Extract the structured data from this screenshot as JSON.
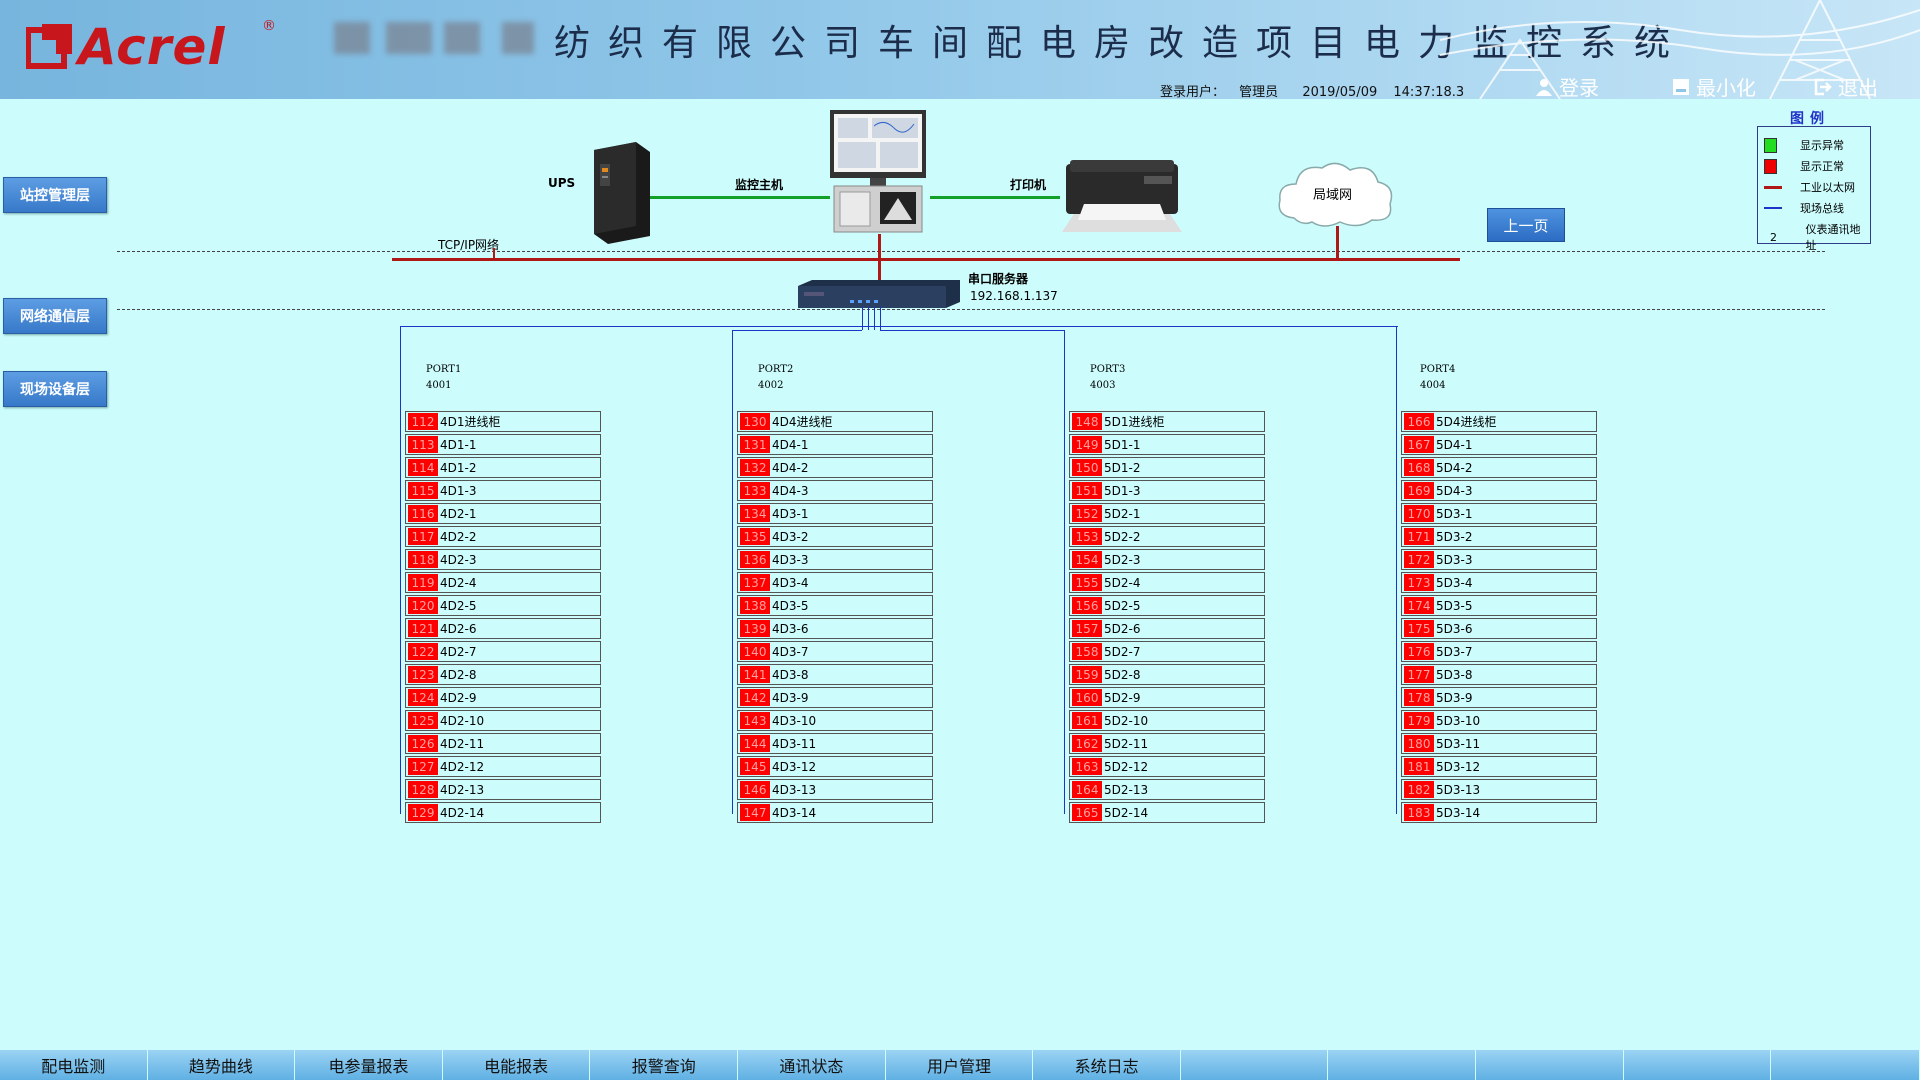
{
  "header": {
    "logo_text": "Acrel",
    "logo_reg": "®",
    "title": "纺织有限公司车间配电房改造项目电力监控系统",
    "login_label": "登录用户：",
    "user": "管理员",
    "date": "2019/05/09",
    "time": "14:37:18.3",
    "buttons": {
      "login": "登录",
      "minimize": "最小化",
      "exit": "退出"
    }
  },
  "layers": {
    "station": "站控管理层",
    "network": "网络通信层",
    "field": "现场设备层"
  },
  "network": {
    "tcp_label": "TCP/IP网络",
    "ups": "UPS",
    "host": "监控主机",
    "printer": "打印机",
    "lan": "局域网",
    "server_title": "串口服务器",
    "server_ip": "192.168.1.137",
    "prev_page": "上一页"
  },
  "legend": {
    "title": "图例",
    "items": [
      {
        "symbol": "green-square",
        "label": "显示异常",
        "color": "#22dd22"
      },
      {
        "symbol": "red-square",
        "label": "显示正常",
        "color": "#ee0000"
      },
      {
        "symbol": "red-line",
        "label": "工业以太网",
        "color": "#b01818"
      },
      {
        "symbol": "blue-line",
        "label": "现场总线",
        "color": "#1d35c7"
      },
      {
        "symbol": "number",
        "label": "仪表通讯地址",
        "text": "2"
      }
    ]
  },
  "ports": [
    {
      "name": "PORT1",
      "num": "4001",
      "devices": [
        {
          "addr": "112",
          "name": "4D1进线柜"
        },
        {
          "addr": "113",
          "name": "4D1-1"
        },
        {
          "addr": "114",
          "name": "4D1-2"
        },
        {
          "addr": "115",
          "name": "4D1-3"
        },
        {
          "addr": "116",
          "name": "4D2-1"
        },
        {
          "addr": "117",
          "name": "4D2-2"
        },
        {
          "addr": "118",
          "name": "4D2-3"
        },
        {
          "addr": "119",
          "name": "4D2-4"
        },
        {
          "addr": "120",
          "name": "4D2-5"
        },
        {
          "addr": "121",
          "name": "4D2-6"
        },
        {
          "addr": "122",
          "name": "4D2-7"
        },
        {
          "addr": "123",
          "name": "4D2-8"
        },
        {
          "addr": "124",
          "name": "4D2-9"
        },
        {
          "addr": "125",
          "name": "4D2-10"
        },
        {
          "addr": "126",
          "name": "4D2-11"
        },
        {
          "addr": "127",
          "name": "4D2-12"
        },
        {
          "addr": "128",
          "name": "4D2-13"
        },
        {
          "addr": "129",
          "name": "4D2-14"
        }
      ]
    },
    {
      "name": "PORT2",
      "num": "4002",
      "devices": [
        {
          "addr": "130",
          "name": "4D4进线柜"
        },
        {
          "addr": "131",
          "name": "4D4-1"
        },
        {
          "addr": "132",
          "name": "4D4-2"
        },
        {
          "addr": "133",
          "name": "4D4-3"
        },
        {
          "addr": "134",
          "name": "4D3-1"
        },
        {
          "addr": "135",
          "name": "4D3-2"
        },
        {
          "addr": "136",
          "name": "4D3-3"
        },
        {
          "addr": "137",
          "name": "4D3-4"
        },
        {
          "addr": "138",
          "name": "4D3-5"
        },
        {
          "addr": "139",
          "name": "4D3-6"
        },
        {
          "addr": "140",
          "name": "4D3-7"
        },
        {
          "addr": "141",
          "name": "4D3-8"
        },
        {
          "addr": "142",
          "name": "4D3-9"
        },
        {
          "addr": "143",
          "name": "4D3-10"
        },
        {
          "addr": "144",
          "name": "4D3-11"
        },
        {
          "addr": "145",
          "name": "4D3-12"
        },
        {
          "addr": "146",
          "name": "4D3-13"
        },
        {
          "addr": "147",
          "name": "4D3-14"
        }
      ]
    },
    {
      "name": "PORT3",
      "num": "4003",
      "devices": [
        {
          "addr": "148",
          "name": "5D1进线柜"
        },
        {
          "addr": "149",
          "name": "5D1-1"
        },
        {
          "addr": "150",
          "name": "5D1-2"
        },
        {
          "addr": "151",
          "name": "5D1-3"
        },
        {
          "addr": "152",
          "name": "5D2-1"
        },
        {
          "addr": "153",
          "name": "5D2-2"
        },
        {
          "addr": "154",
          "name": "5D2-3"
        },
        {
          "addr": "155",
          "name": "5D2-4"
        },
        {
          "addr": "156",
          "name": "5D2-5"
        },
        {
          "addr": "157",
          "name": "5D2-6"
        },
        {
          "addr": "158",
          "name": "5D2-7"
        },
        {
          "addr": "159",
          "name": "5D2-8"
        },
        {
          "addr": "160",
          "name": "5D2-9"
        },
        {
          "addr": "161",
          "name": "5D2-10"
        },
        {
          "addr": "162",
          "name": "5D2-11"
        },
        {
          "addr": "163",
          "name": "5D2-12"
        },
        {
          "addr": "164",
          "name": "5D2-13"
        },
        {
          "addr": "165",
          "name": "5D2-14"
        }
      ]
    },
    {
      "name": "PORT4",
      "num": "4004",
      "devices": [
        {
          "addr": "166",
          "name": "5D4进线柜"
        },
        {
          "addr": "167",
          "name": "5D4-1"
        },
        {
          "addr": "168",
          "name": "5D4-2"
        },
        {
          "addr": "169",
          "name": "5D4-3"
        },
        {
          "addr": "170",
          "name": "5D3-1"
        },
        {
          "addr": "171",
          "name": "5D3-2"
        },
        {
          "addr": "172",
          "name": "5D3-3"
        },
        {
          "addr": "173",
          "name": "5D3-4"
        },
        {
          "addr": "174",
          "name": "5D3-5"
        },
        {
          "addr": "175",
          "name": "5D3-6"
        },
        {
          "addr": "176",
          "name": "5D3-7"
        },
        {
          "addr": "177",
          "name": "5D3-8"
        },
        {
          "addr": "178",
          "name": "5D3-9"
        },
        {
          "addr": "179",
          "name": "5D3-10"
        },
        {
          "addr": "180",
          "name": "5D3-11"
        },
        {
          "addr": "181",
          "name": "5D3-12"
        },
        {
          "addr": "182",
          "name": "5D3-13"
        },
        {
          "addr": "183",
          "name": "5D3-14"
        }
      ]
    }
  ],
  "tabs": [
    "配电监测",
    "趋势曲线",
    "电参量报表",
    "电能报表",
    "报警查询",
    "通讯状态",
    "用户管理",
    "系统日志",
    "",
    "",
    "",
    "",
    ""
  ]
}
